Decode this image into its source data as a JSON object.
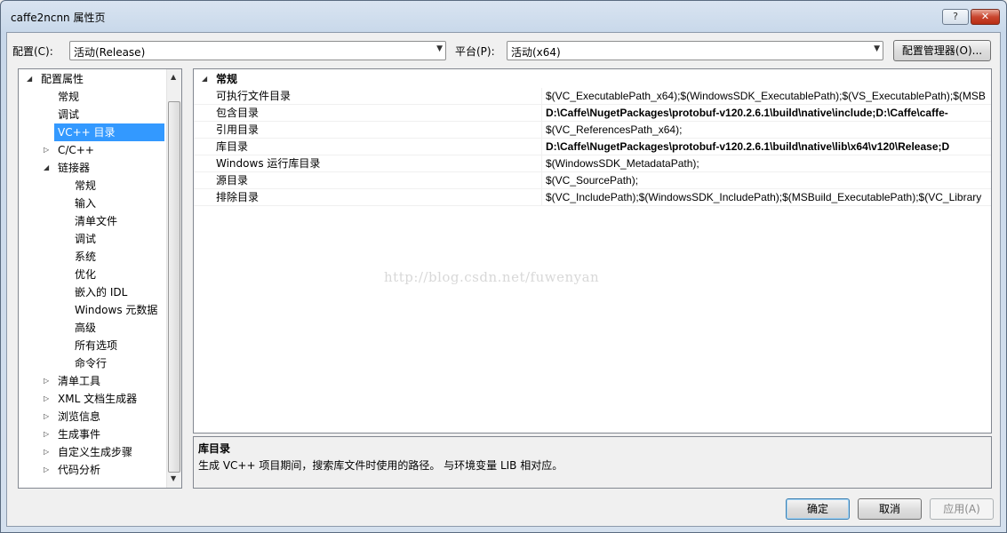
{
  "window": {
    "title": "caffe2ncnn 属性页",
    "help_label": "?",
    "close_label": "✕"
  },
  "toolbar": {
    "config_label": "配置(C):",
    "config_value": "活动(Release)",
    "platform_label": "平台(P):",
    "platform_value": "活动(x64)",
    "config_manager_label": "配置管理器(O)..."
  },
  "tree": {
    "items": [
      {
        "label": "配置属性",
        "expander": "◢"
      },
      {
        "label": "常规"
      },
      {
        "label": "调试"
      },
      {
        "label": "VC++ 目录",
        "selected": true
      },
      {
        "label": "C/C++",
        "expander": "▷"
      },
      {
        "label": "链接器",
        "expander": "◢"
      },
      {
        "label": "常规"
      },
      {
        "label": "输入"
      },
      {
        "label": "清单文件"
      },
      {
        "label": "调试"
      },
      {
        "label": "系统"
      },
      {
        "label": "优化"
      },
      {
        "label": "嵌入的 IDL"
      },
      {
        "label": "Windows 元数据"
      },
      {
        "label": "高级"
      },
      {
        "label": "所有选项"
      },
      {
        "label": "命令行"
      },
      {
        "label": "清单工具",
        "expander": "▷"
      },
      {
        "label": "XML 文档生成器",
        "expander": "▷"
      },
      {
        "label": "浏览信息",
        "expander": "▷"
      },
      {
        "label": "生成事件",
        "expander": "▷"
      },
      {
        "label": "自定义生成步骤",
        "expander": "▷"
      },
      {
        "label": "代码分析",
        "expander": "▷"
      }
    ]
  },
  "grid": {
    "category": "常规",
    "category_expander": "◢",
    "rows": [
      {
        "name": "可执行文件目录",
        "value": "$(VC_ExecutablePath_x64);$(WindowsSDK_ExecutablePath);$(VS_ExecutablePath);$(MSB",
        "bold": false
      },
      {
        "name": "包含目录",
        "value": "D:\\Caffe\\NugetPackages\\protobuf-v120.2.6.1\\build\\native\\include;D:\\Caffe\\caffe-",
        "bold": true
      },
      {
        "name": "引用目录",
        "value": "$(VC_ReferencesPath_x64);",
        "bold": false
      },
      {
        "name": "库目录",
        "value": "D:\\Caffe\\NugetPackages\\protobuf-v120.2.6.1\\build\\native\\lib\\x64\\v120\\Release;D",
        "bold": true
      },
      {
        "name": "Windows 运行库目录",
        "value": "$(WindowsSDK_MetadataPath);",
        "bold": false
      },
      {
        "name": "源目录",
        "value": "$(VC_SourcePath);",
        "bold": false
      },
      {
        "name": "排除目录",
        "value": "$(VC_IncludePath);$(WindowsSDK_IncludePath);$(MSBuild_ExecutablePath);$(VC_Library",
        "bold": false
      }
    ],
    "watermark": "http://blog.csdn.net/fuwenyan"
  },
  "description": {
    "title": "库目录",
    "text": "生成 VC++ 项目期间，搜索库文件时使用的路径。 与环境变量 LIB 相对应。"
  },
  "buttons": {
    "ok": "确定",
    "cancel": "取消",
    "apply": "应用(A)"
  }
}
